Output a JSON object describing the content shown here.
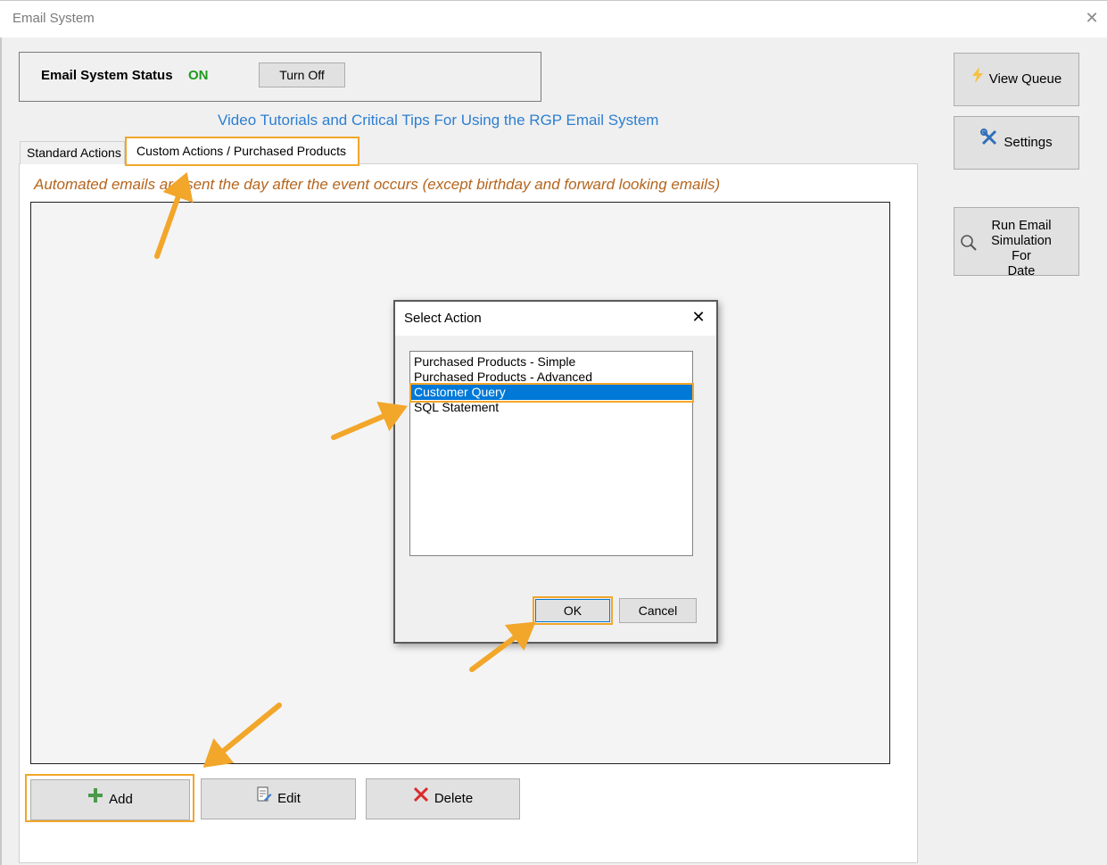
{
  "window": {
    "title": "Email System",
    "close_glyph": "✕"
  },
  "status": {
    "label": "Email System Status",
    "value": "ON",
    "value_color": "#1e9a1e",
    "toggle_label": "Turn Off"
  },
  "tutorial_link": "Video Tutorials and Critical Tips For Using the RGP Email System",
  "tabs": [
    {
      "label": "Standard Actions",
      "active": false
    },
    {
      "label": "Custom Actions / Purchased Products",
      "active": true
    }
  ],
  "notice": "Automated emails are sent the day after the event occurs (except birthday and forward looking emails)",
  "actions": {
    "add_label": "Add",
    "add_icon": "plus-icon",
    "edit_label": "Edit",
    "edit_icon": "edit-document-icon",
    "delete_label": "Delete",
    "delete_icon": "x-mark-icon"
  },
  "side_buttons": {
    "view_queue": {
      "label": "View Queue",
      "icon": "lightning-icon"
    },
    "settings": {
      "label": "Settings",
      "icon": "tools-icon"
    },
    "run_simulation": {
      "label": "Run Email\nSimulation For\nDate",
      "icon": "magnifier-icon"
    }
  },
  "dialog": {
    "title": "Select Action",
    "close_glyph": "✕",
    "items": [
      "Purchased Products - Simple",
      "Purchased Products - Advanced",
      "Customer Query",
      "SQL Statement"
    ],
    "selected_index": 2,
    "ok_label": "OK",
    "cancel_label": "Cancel"
  },
  "colors": {
    "highlight": "#f2a62a",
    "selection": "#0078d7",
    "link": "#2d7fd1",
    "notice": "#b5651d"
  }
}
